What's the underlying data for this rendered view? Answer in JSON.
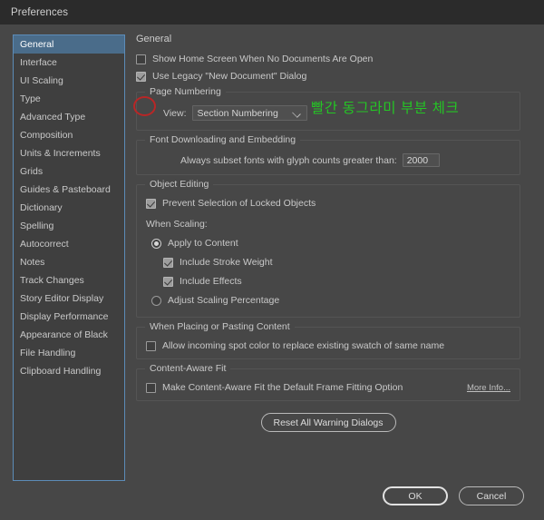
{
  "window": {
    "title": "Preferences"
  },
  "sidebar": {
    "items": [
      {
        "label": "General",
        "selected": true
      },
      {
        "label": "Interface",
        "selected": false
      },
      {
        "label": "UI Scaling",
        "selected": false
      },
      {
        "label": "Type",
        "selected": false
      },
      {
        "label": "Advanced Type",
        "selected": false
      },
      {
        "label": "Composition",
        "selected": false
      },
      {
        "label": "Units & Increments",
        "selected": false
      },
      {
        "label": "Grids",
        "selected": false
      },
      {
        "label": "Guides & Pasteboard",
        "selected": false
      },
      {
        "label": "Dictionary",
        "selected": false
      },
      {
        "label": "Spelling",
        "selected": false
      },
      {
        "label": "Autocorrect",
        "selected": false
      },
      {
        "label": "Notes",
        "selected": false
      },
      {
        "label": "Track Changes",
        "selected": false
      },
      {
        "label": "Story Editor Display",
        "selected": false
      },
      {
        "label": "Display Performance",
        "selected": false
      },
      {
        "label": "Appearance of Black",
        "selected": false
      },
      {
        "label": "File Handling",
        "selected": false
      },
      {
        "label": "Clipboard Handling",
        "selected": false
      }
    ]
  },
  "panel": {
    "heading": "General",
    "show_home_screen": {
      "label": "Show Home Screen When No Documents Are Open",
      "checked": false
    },
    "use_legacy_dialog": {
      "label": "Use Legacy \"New Document\" Dialog",
      "checked": true
    },
    "page_numbering": {
      "group_label": "Page Numbering",
      "view_label": "View:",
      "view_value": "Section Numbering"
    },
    "font_downloading": {
      "group_label": "Font Downloading and Embedding",
      "subset_label": "Always subset fonts with glyph counts greater than:",
      "subset_value": "2000"
    },
    "object_editing": {
      "group_label": "Object Editing",
      "prevent_selection": {
        "label": "Prevent Selection of Locked Objects",
        "checked": true
      },
      "when_scaling_label": "When Scaling:",
      "apply_to_content": {
        "label": "Apply to Content",
        "checked": true
      },
      "include_stroke_weight": {
        "label": "Include Stroke Weight",
        "checked": true
      },
      "include_effects": {
        "label": "Include Effects",
        "checked": true
      },
      "adjust_scaling_percentage": {
        "label": "Adjust Scaling Percentage",
        "checked": false
      }
    },
    "placing_pasting": {
      "group_label": "When Placing or Pasting Content",
      "allow_spot_color": {
        "label": "Allow incoming spot color to replace existing swatch of same name",
        "checked": false
      }
    },
    "content_aware_fit": {
      "group_label": "Content-Aware Fit",
      "make_default": {
        "label": "Make Content-Aware Fit the Default Frame Fitting Option",
        "checked": false
      },
      "more_info_label": "More Info..."
    },
    "reset_button_label": "Reset All Warning Dialogs"
  },
  "footer": {
    "ok_label": "OK",
    "cancel_label": "Cancel"
  },
  "annotations": {
    "note_text": "빨간 동그라미 부분 체크",
    "note_color": "#24c624",
    "circle_color": "#b92626"
  }
}
